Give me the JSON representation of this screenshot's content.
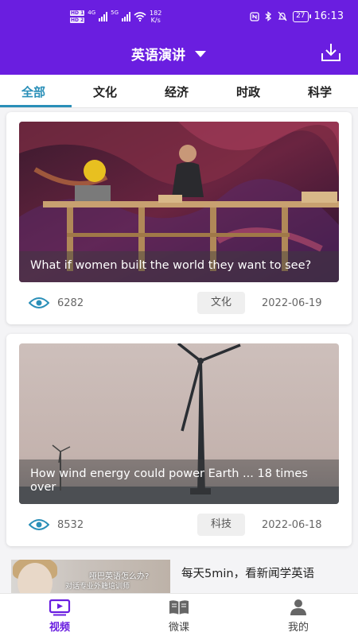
{
  "status_bar": {
    "hd_badges": [
      "HD 1",
      "HD 2"
    ],
    "network_1": "4G",
    "network_2": "5G",
    "speed_value": "182",
    "speed_unit": "K/s",
    "battery": "27",
    "time": "16:13"
  },
  "header": {
    "title": "英语演讲"
  },
  "tabs": [
    {
      "label": "全部",
      "active": true
    },
    {
      "label": "文化",
      "active": false
    },
    {
      "label": "经济",
      "active": false
    },
    {
      "label": "时政",
      "active": false
    },
    {
      "label": "科学",
      "active": false
    }
  ],
  "videos": [
    {
      "title": "What if women built the world they want to see?",
      "views": "6282",
      "tag": "文化",
      "date": "2022-06-19"
    },
    {
      "title": "How wind energy could power Earth ... 18 times over",
      "views": "8532",
      "tag": "科技",
      "date": "2022-06-18"
    }
  ],
  "banner": {
    "image_text_1": "哑巴英语怎么办?",
    "image_text_2": "对话专业外籍培训师",
    "text": "每天5min，看新闻学英语"
  },
  "bottom_nav": [
    {
      "label": "视频",
      "icon": "video-icon",
      "active": true
    },
    {
      "label": "微课",
      "icon": "book-icon",
      "active": false
    },
    {
      "label": "我的",
      "icon": "person-icon",
      "active": false
    }
  ],
  "colors": {
    "primary": "#6a1ee0",
    "tab_active": "#2a8fb8",
    "eye_icon": "#2a8fb8"
  }
}
